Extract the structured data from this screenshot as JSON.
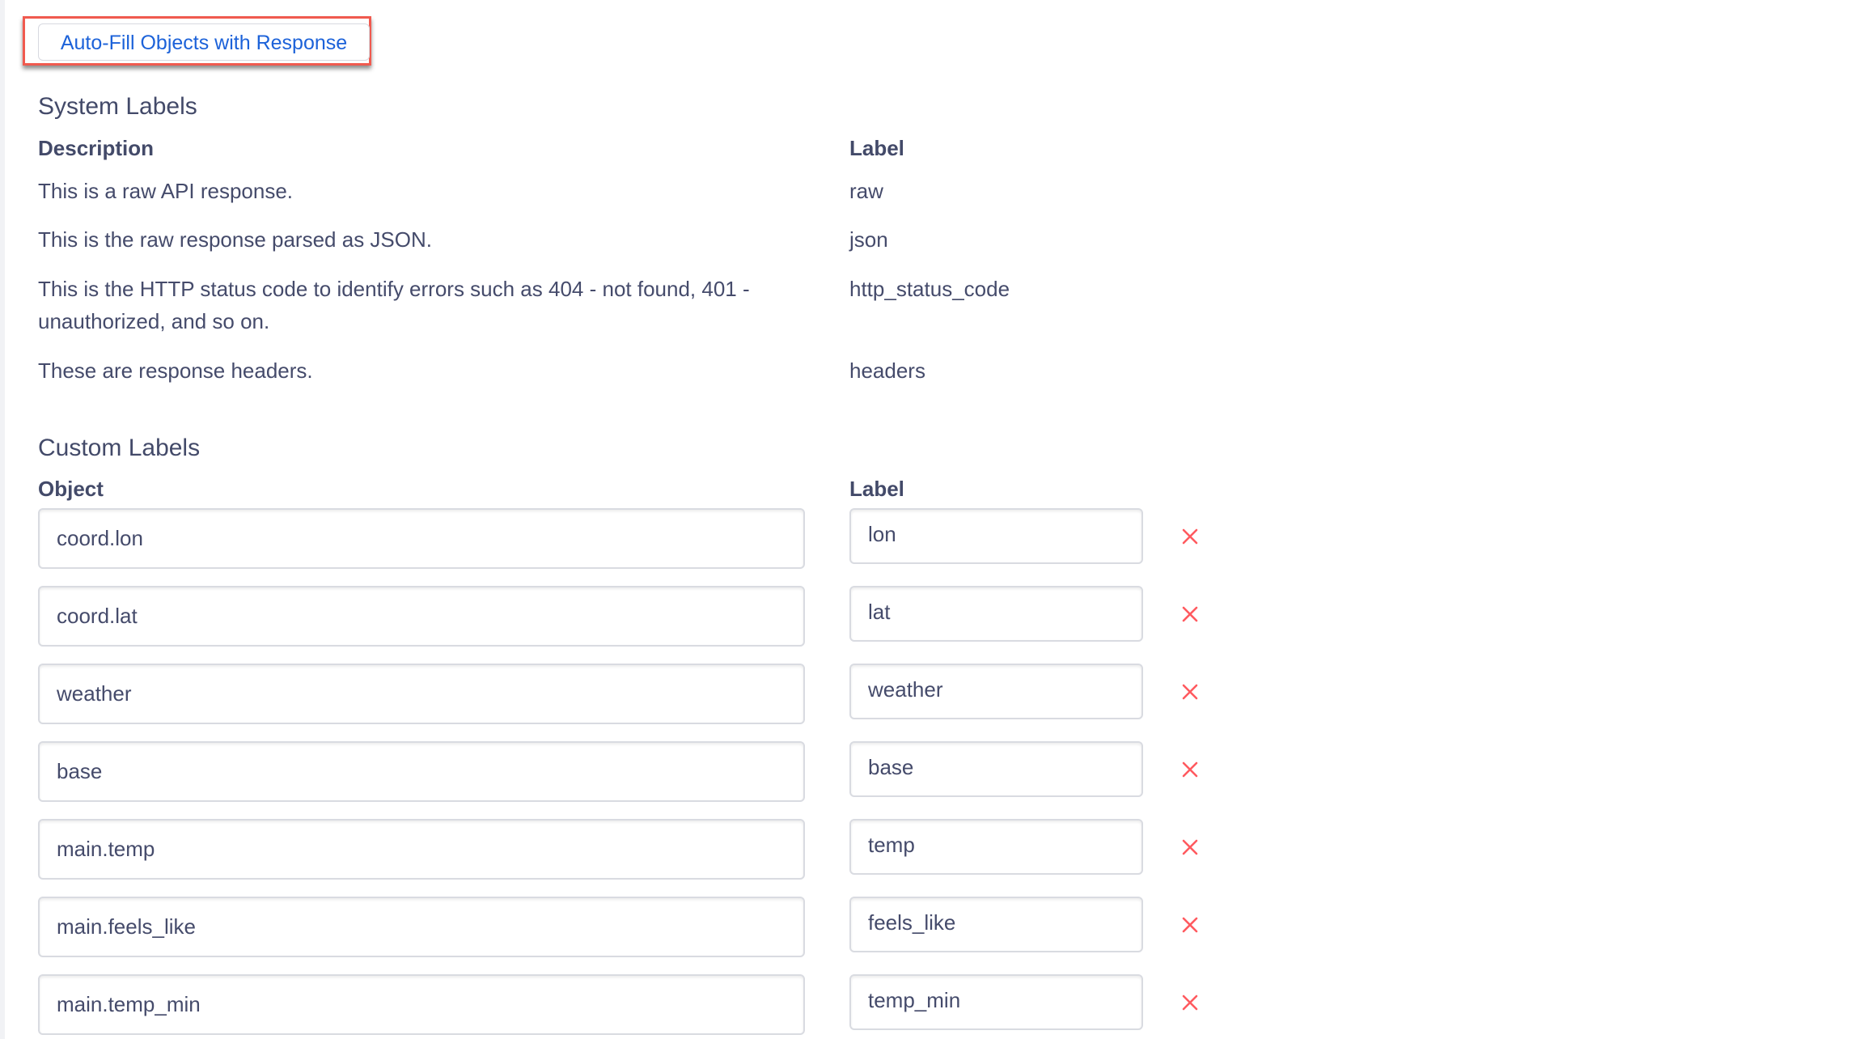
{
  "toolbar": {
    "autofill_label": "Auto-Fill Objects with Response"
  },
  "system_labels": {
    "title": "System Labels",
    "headers": {
      "description": "Description",
      "label": "Label"
    },
    "rows": [
      {
        "description": "This is a raw API response.",
        "label": "raw"
      },
      {
        "description": "This is the raw response parsed as JSON.",
        "label": "json"
      },
      {
        "description": "This is the HTTP status code to identify errors such as 404 - not found, 401 - unauthorized, and so on.",
        "label": "http_status_code"
      },
      {
        "description": "These are response headers.",
        "label": "headers"
      }
    ]
  },
  "custom_labels": {
    "title": "Custom Labels",
    "headers": {
      "object": "Object",
      "label": "Label"
    },
    "rows": [
      {
        "object": "coord.lon",
        "label": "lon"
      },
      {
        "object": "coord.lat",
        "label": "lat"
      },
      {
        "object": "weather",
        "label": "weather"
      },
      {
        "object": "base",
        "label": "base"
      },
      {
        "object": "main.temp",
        "label": "temp"
      },
      {
        "object": "main.feels_like",
        "label": "feels_like"
      },
      {
        "object": "main.temp_min",
        "label": "temp_min"
      }
    ],
    "remove_icon": "close-x-icon"
  },
  "colors": {
    "accent_link": "#1c62d9",
    "highlight_border": "#f05a4f",
    "remove_icon": "#ff5a5f",
    "text": "#454b6b"
  }
}
